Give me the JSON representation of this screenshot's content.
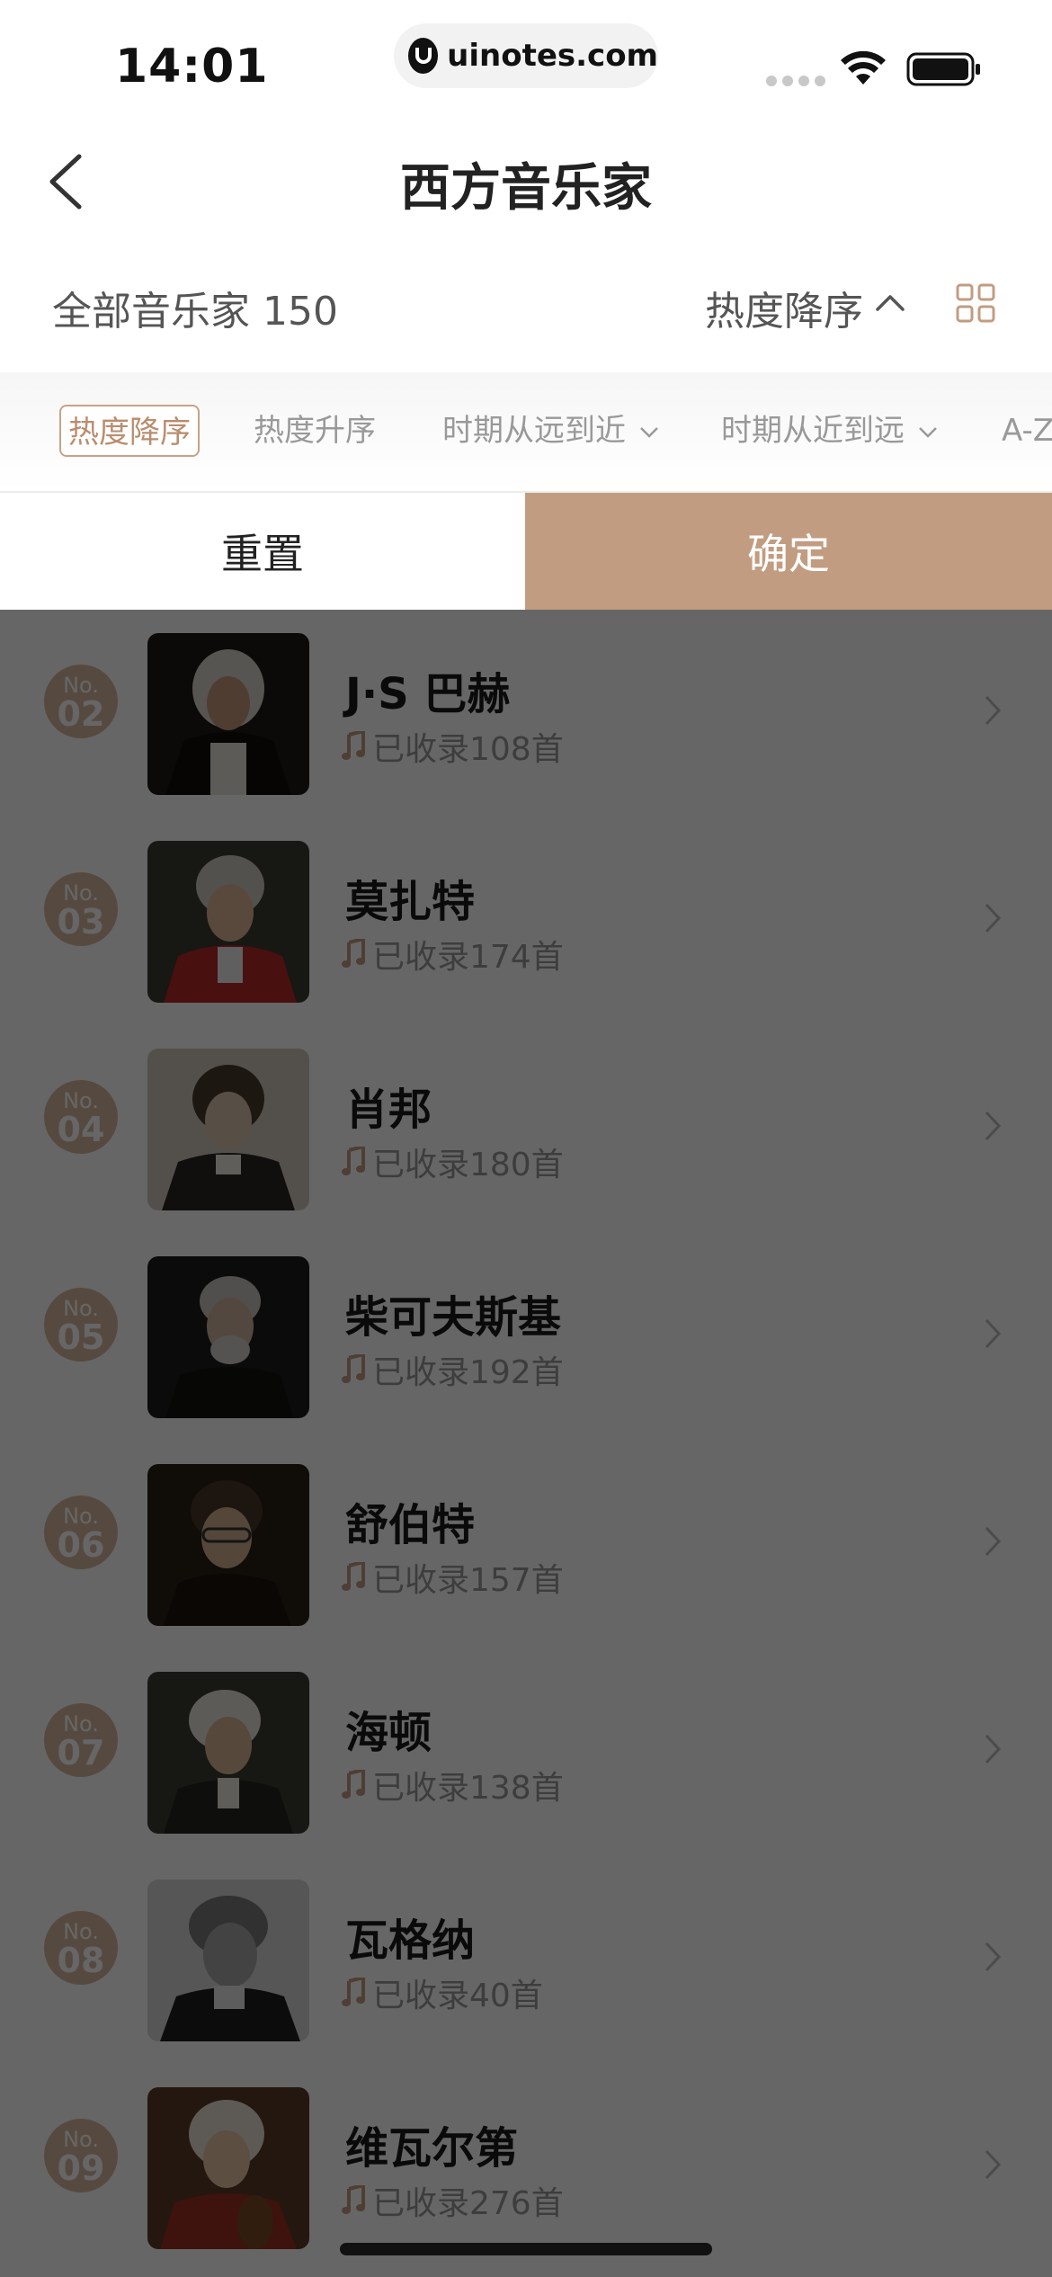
{
  "status_bar": {
    "time": "14:01",
    "url": "uinotes.com"
  },
  "nav": {
    "title": "西方音乐家"
  },
  "toolbar": {
    "count_label": "全部音乐家 150",
    "sort_label": "热度降序"
  },
  "sort_options": [
    {
      "label": "热度降序",
      "active": true,
      "has_chevron": false
    },
    {
      "label": "热度升序",
      "active": false,
      "has_chevron": false
    },
    {
      "label": "时期从远到近",
      "active": false,
      "has_chevron": true
    },
    {
      "label": "时期从近到远",
      "active": false,
      "has_chevron": true
    },
    {
      "label": "A-Z",
      "active": false,
      "has_chevron": false
    }
  ],
  "actions": {
    "reset_label": "重置",
    "confirm_label": "确定"
  },
  "musicians": [
    {
      "rank_prefix": "No.",
      "rank": "02",
      "name": "J·S 巴赫",
      "count_text": "已收录108首"
    },
    {
      "rank_prefix": "No.",
      "rank": "03",
      "name": "莫扎特",
      "count_text": "已收录174首"
    },
    {
      "rank_prefix": "No.",
      "rank": "04",
      "name": "肖邦",
      "count_text": "已收录180首"
    },
    {
      "rank_prefix": "No.",
      "rank": "05",
      "name": "柴可夫斯基",
      "count_text": "已收录192首"
    },
    {
      "rank_prefix": "No.",
      "rank": "06",
      "name": "舒伯特",
      "count_text": "已收录157首"
    },
    {
      "rank_prefix": "No.",
      "rank": "07",
      "name": "海顿",
      "count_text": "已收录138首"
    },
    {
      "rank_prefix": "No.",
      "rank": "08",
      "name": "瓦格纳",
      "count_text": "已收录40首"
    },
    {
      "rank_prefix": "No.",
      "rank": "09",
      "name": "维瓦尔第",
      "count_text": "已收录276首"
    }
  ],
  "colors": {
    "accent": "#c29c80",
    "badge": "#d8b9a0",
    "overlay": "rgba(0,0,0,0.6)"
  }
}
